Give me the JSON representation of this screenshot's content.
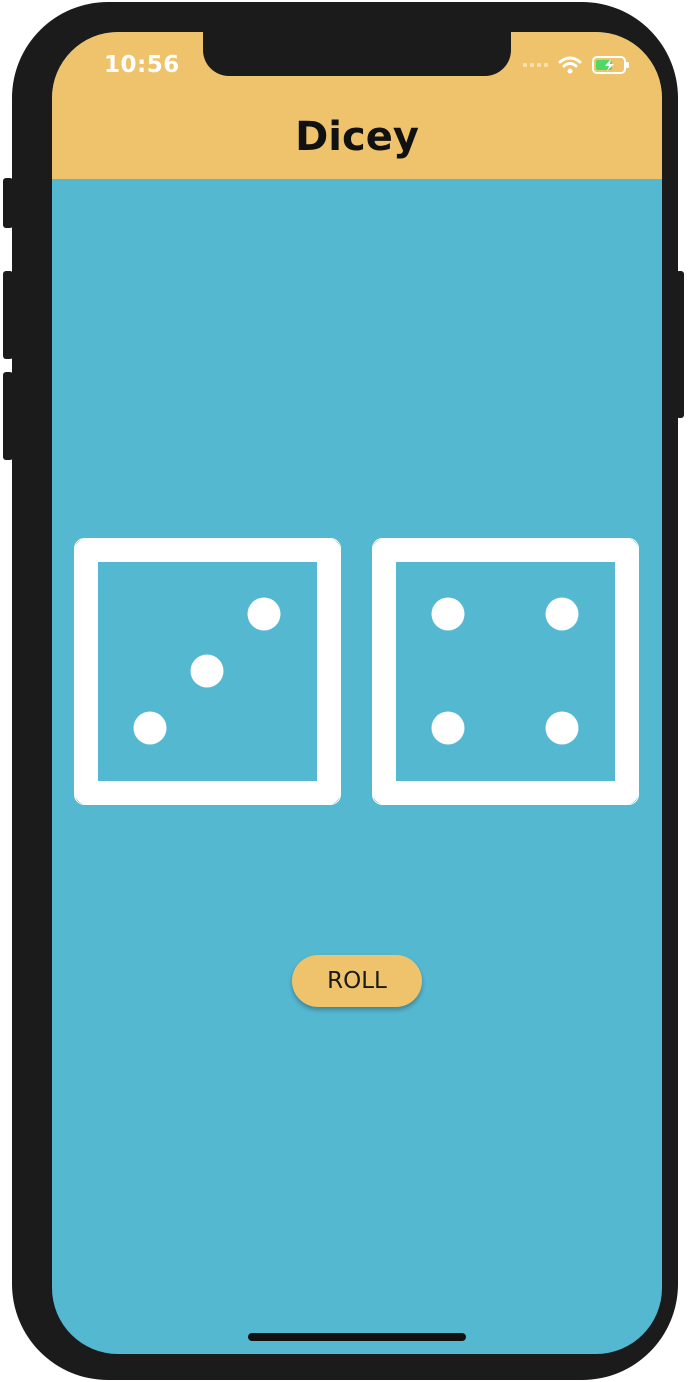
{
  "status_bar": {
    "time": "10:56",
    "icons": [
      "signal-dots-icon",
      "wifi-icon",
      "battery-charging-icon"
    ]
  },
  "app_bar": {
    "title": "Dicey",
    "color": "#efc36b"
  },
  "dice": [
    {
      "name": "left-die",
      "face": 3
    },
    {
      "name": "right-die",
      "face": 4
    }
  ],
  "roll_button": {
    "label": "ROLL",
    "color": "#efc36b"
  },
  "colors": {
    "background": "#55b8d1",
    "die": "#ffffff"
  }
}
